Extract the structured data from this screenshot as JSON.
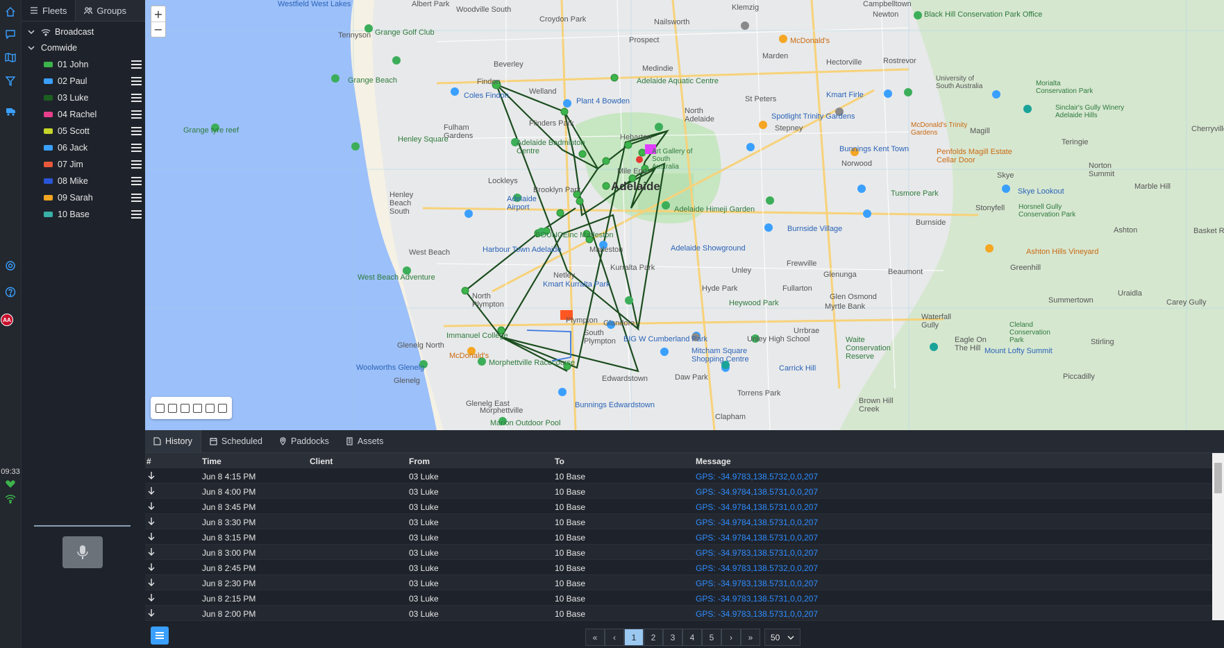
{
  "sidebar": {
    "tabs": [
      {
        "label": "Fleets"
      },
      {
        "label": "Groups"
      }
    ],
    "groups": [
      {
        "label": "Broadcast"
      },
      {
        "label": "Comwide"
      }
    ],
    "units": [
      {
        "label": "01 John",
        "icon": "truck-icon",
        "color": "#3cb44b"
      },
      {
        "label": "02 Paul",
        "icon": "walker-icon",
        "color": "#3aa0ff"
      },
      {
        "label": "03 Luke",
        "icon": "truck-icon",
        "color": "#1b5e20"
      },
      {
        "label": "04 Rachel",
        "icon": "motorbike-icon",
        "color": "#e83e8c"
      },
      {
        "label": "05 Scott",
        "icon": "bicycle-icon",
        "color": "#c6d52a"
      },
      {
        "label": "06 Jack",
        "icon": "bus-icon",
        "color": "#3aa0ff"
      },
      {
        "label": "07 Jim",
        "icon": "person-icon",
        "color": "#e8583a"
      },
      {
        "label": "08 Mike",
        "icon": "person-icon",
        "color": "#2a55d8"
      },
      {
        "label": "09 Sarah",
        "icon": "person-icon",
        "color": "#f5a623"
      },
      {
        "label": "10 Base",
        "icon": "monitor-icon",
        "color": "#3ab0a8"
      }
    ]
  },
  "status": {
    "time": "09:33",
    "avatar": "AA"
  },
  "map": {
    "zoom_in": "+",
    "zoom_out": "−",
    "labels": {
      "adelaide": "Adelaide",
      "westfield": "Westfield West Lakes",
      "woodville": "Woodville South",
      "albertpark": "Albert Park",
      "croydon": "Croydon Park",
      "nailsworth": "Nailsworth",
      "klemzig": "Klemzig",
      "campbelltown": "Campbelltown",
      "newton": "Newton",
      "blackhill": "Black Hill Conservation Park Office",
      "tennyson": "Tennyson",
      "grangegolf": "Grange Golf Club",
      "prospect": "Prospect",
      "mcdonalds": "McDonald's",
      "beverley": "Beverley",
      "findon": "Findon",
      "welland": "Welland",
      "medindie": "Medindie",
      "marden": "Marden",
      "hectorville": "Hectorville",
      "rostrevor": "Rostrevor",
      "grangebeach": "Grange Beach",
      "adelaideaquatic": "Adelaide Aquatic Centre",
      "coles": "Coles Findon",
      "plant4": "Plant 4 Bowden",
      "stpeters": "St Peters",
      "kmart": "Kmart Firle",
      "uniadelaide": "University of South Australia",
      "morialta": "Morialta Conservation Park",
      "fulham": "Fulham Gardens",
      "flinders": "Flinders Park",
      "northadelaide": "North Adelaide",
      "spotlight": "Spotlight Trinity Gardens",
      "stepney": "Stepney",
      "magill": "Magill",
      "grangetyre": "Grange tyre reef",
      "henleysq": "Henley Square",
      "badminton": "Adelaide Badminton Centre",
      "hebarton": "Hebarton",
      "artgallery": "Art Gallery of South Australia",
      "bunnings": "Bunnings Kent Town",
      "norwood": "Norwood",
      "penfolds": "Penfolds Magill Estate Cellar Door",
      "teringie": "Teringie",
      "henley": "Henley Beach South",
      "lockleys": "Lockleys",
      "mileend": "Mile End",
      "brooklyn": "Brooklyn Park",
      "airport": "Adelaide Airport",
      "bounce": "BOUNCEinc Marleston",
      "himeji": "Adelaide Himeji Garden",
      "tusmore": "Tusmore Park",
      "skye": "Skye",
      "skyelookout": "Skye Lookout",
      "stonyfell": "Stonyfell",
      "norton": "Norton Summit",
      "marblehill": "Marble Hill",
      "westbeach": "West Beach",
      "harbourtown": "Harbour Town Adelaide",
      "marleston": "Marleston",
      "showground": "Adelaide Showground",
      "burnside": "Burnside Village",
      "burnsidesub": "Burnside",
      "horsnell": "Horsnell Gully Conservation Park",
      "ashton": "Ashton",
      "ashtonvineyard": "Ashton Hills Vineyard",
      "westbeachadv": "West Beach Adventure",
      "kurralta": "Kurralta Park",
      "unley": "Unley",
      "frewville": "Frewville",
      "glenunga": "Glenunga",
      "beaumont": "Beaumont",
      "greenhill": "Greenhill",
      "netley": "Netley",
      "kmartkurralta": "Kmart Kurralta Park",
      "hydepark": "Hyde Park",
      "fullarton": "Fullarton",
      "glenosmond": "Glen Osmond",
      "northplympton": "North Plympton",
      "heywood": "Heywood Park",
      "myrtlebank": "Myrtle Bank",
      "summertown": "Summertown",
      "uraidla": "Uraidla",
      "plympton": "Plympton",
      "glandore": "Glandore",
      "urrbrae": "Urrbrae",
      "waterfall": "Waterfall Gully",
      "cleland": "Cleland Conservation Park",
      "immanuel": "Immanuel College",
      "southplympton": "South Plympton",
      "bigw": "BIG W Cumberland Park",
      "unleyhigh": "Unley High School",
      "waite": "Waite Conservation Reserve",
      "eagle": "Eagle On The Hill",
      "mountlofty": "Mount Lofty Summit",
      "glenelgnorth": "Glenelg North",
      "mcdonaldsglenelg": "McDonald's",
      "morphettville": "Morphettville Racecourse",
      "mitcham": "Mitcham Square Shopping Centre",
      "carrick": "Carrick Hill",
      "piccadilly": "Piccadilly",
      "woolworths": "Woolworths Glenelg",
      "glenelg": "Glenelg",
      "edwardstown": "Edwardstown",
      "dawpark": "Daw Park",
      "brownhill": "Brown Hill Creek",
      "torrens": "Torrens Park",
      "glenelgeast": "Glenelg East",
      "bunningsedw": "Bunnings Edwardstown",
      "morphettvillesub": "Morphettville",
      "clapham": "Clapham",
      "marion": "Marion Outdoor Pool",
      "stirling": "Stirling",
      "careygully": "Carey Gully",
      "basket": "Basket Range",
      "cherry": "Cherryville",
      "sinclair": "Sinclair's Gully Winery Adelaide Hills",
      "mcdonaldstrinity": "McDonald's Trinity Gardens"
    }
  },
  "bottom": {
    "tabs": [
      {
        "label": "History"
      },
      {
        "label": "Scheduled"
      },
      {
        "label": "Paddocks"
      },
      {
        "label": "Assets"
      }
    ],
    "columns": [
      "#",
      "Time",
      "Client",
      "From",
      "To",
      "Message"
    ],
    "rows": [
      {
        "time": "Jun 8 4:15 PM",
        "client": "",
        "from": "03 Luke",
        "to": "10 Base",
        "message": "GPS: -34.9783,138.5732,0,0,207"
      },
      {
        "time": "Jun 8 4:00 PM",
        "client": "",
        "from": "03 Luke",
        "to": "10 Base",
        "message": "GPS: -34.9784,138.5731,0,0,207"
      },
      {
        "time": "Jun 8 3:45 PM",
        "client": "",
        "from": "03 Luke",
        "to": "10 Base",
        "message": "GPS: -34.9784,138.5731,0,0,207"
      },
      {
        "time": "Jun 8 3:30 PM",
        "client": "",
        "from": "03 Luke",
        "to": "10 Base",
        "message": "GPS: -34.9784,138.5731,0,0,207"
      },
      {
        "time": "Jun 8 3:15 PM",
        "client": "",
        "from": "03 Luke",
        "to": "10 Base",
        "message": "GPS: -34.9784,138.5731,0,0,207"
      },
      {
        "time": "Jun 8 3:00 PM",
        "client": "",
        "from": "03 Luke",
        "to": "10 Base",
        "message": "GPS: -34.9783,138.5731,0,0,207"
      },
      {
        "time": "Jun 8 2:45 PM",
        "client": "",
        "from": "03 Luke",
        "to": "10 Base",
        "message": "GPS: -34.9783,138.5732,0,0,207"
      },
      {
        "time": "Jun 8 2:30 PM",
        "client": "",
        "from": "03 Luke",
        "to": "10 Base",
        "message": "GPS: -34.9783,138.5731,0,0,207"
      },
      {
        "time": "Jun 8 2:15 PM",
        "client": "",
        "from": "03 Luke",
        "to": "10 Base",
        "message": "GPS: -34.9783,138.5731,0,0,207"
      },
      {
        "time": "Jun 8 2:00 PM",
        "client": "",
        "from": "03 Luke",
        "to": "10 Base",
        "message": "GPS: -34.9783,138.5731,0,0,207"
      }
    ],
    "pager": {
      "first": "«",
      "prev": "‹",
      "pages": [
        "1",
        "2",
        "3",
        "4",
        "5"
      ],
      "current": "1",
      "next": "›",
      "last": "»",
      "page_size": "50"
    }
  },
  "colors": {
    "accent": "#3aa0ff",
    "link": "#2f8cff",
    "route": "#1b4d1f",
    "marker": "#3cb44b"
  }
}
